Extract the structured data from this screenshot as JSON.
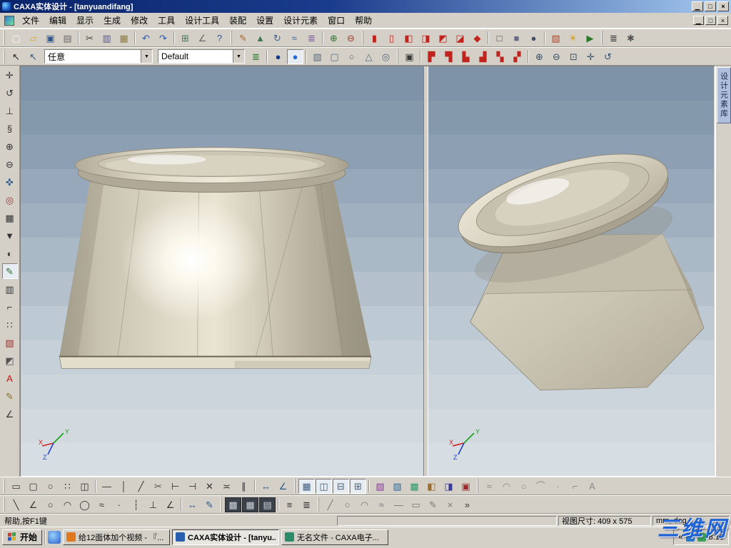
{
  "window": {
    "title": "CAXA实体设计 - [tanyuandifang]"
  },
  "icons": {
    "minimize": "▁",
    "maximize": "□",
    "close": "×",
    "combo_arrow": "▼",
    "tray_collapse": "«"
  },
  "menubar": {
    "items": [
      "文件",
      "编辑",
      "显示",
      "生成",
      "修改",
      "工具",
      "设计工具",
      "装配",
      "设置",
      "设计元素",
      "窗口",
      "帮助"
    ]
  },
  "toolbar_top": {
    "icons": [
      {
        "n": "toolbar-grip",
        "cls": "grip"
      },
      {
        "n": "new-file-icon",
        "g": "▢",
        "c": "#f8f8f4"
      },
      {
        "n": "open-file-icon",
        "g": "▱",
        "c": "#d8a83c"
      },
      {
        "n": "save-icon",
        "g": "▣",
        "c": "#31568c"
      },
      {
        "n": "print-icon",
        "g": "▤",
        "c": "#6a6a6a"
      },
      {
        "n": "separator",
        "cls": "sep",
        "iv": "false"
      },
      {
        "n": "cut-icon",
        "g": "✂",
        "c": "#444444"
      },
      {
        "n": "copy-icon",
        "g": "▥",
        "c": "#5a5a78"
      },
      {
        "n": "paste-icon",
        "g": "▦",
        "c": "#8a7a4a"
      },
      {
        "n": "separator",
        "cls": "sep",
        "iv": "false"
      },
      {
        "n": "undo-icon",
        "g": "↶",
        "c": "#2d56a8"
      },
      {
        "n": "redo-icon",
        "g": "↷",
        "c": "#2d56a8"
      },
      {
        "n": "separator",
        "cls": "sep",
        "iv": "false"
      },
      {
        "n": "grid-icon",
        "g": "⊞",
        "c": "#3a7a5a"
      },
      {
        "n": "measure-icon",
        "g": "∠",
        "c": "#666666"
      },
      {
        "n": "context-help-icon",
        "g": "?",
        "c": "#2d56a8"
      },
      {
        "n": "toolbar-grip",
        "cls": "grip"
      },
      {
        "n": "sketch-2d-icon",
        "g": "✎",
        "c": "#a8662a"
      },
      {
        "n": "extrude-feature-icon",
        "g": "▲",
        "c": "#3d7a52"
      },
      {
        "n": "revolve-feature-icon",
        "g": "↻",
        "c": "#35679e"
      },
      {
        "n": "sweep-feature-icon",
        "g": "≈",
        "c": "#35679e"
      },
      {
        "n": "loft-feature-icon",
        "g": "≣",
        "c": "#7a5aa0"
      },
      {
        "n": "separator",
        "cls": "sep",
        "iv": "false"
      },
      {
        "n": "boolean-add-icon",
        "g": "⊕",
        "c": "#2a7a2a"
      },
      {
        "n": "boolean-subtract-icon",
        "g": "⊖",
        "c": "#a03a2a"
      },
      {
        "n": "toolbar-grip",
        "cls": "grip"
      },
      {
        "n": "view-front-icon",
        "g": "▮",
        "c": "#c0241c"
      },
      {
        "n": "view-back-icon",
        "g": "▯",
        "c": "#c0241c"
      },
      {
        "n": "view-left-icon",
        "g": "◧",
        "c": "#c0241c"
      },
      {
        "n": "view-right-icon",
        "g": "◨",
        "c": "#c0241c"
      },
      {
        "n": "view-top-icon",
        "g": "◩",
        "c": "#c0241c"
      },
      {
        "n": "view-bottom-icon",
        "g": "◪",
        "c": "#c0241c"
      },
      {
        "n": "view-iso-icon",
        "g": "◆",
        "c": "#c0241c"
      },
      {
        "n": "separator",
        "cls": "sep",
        "iv": "false"
      },
      {
        "n": "display-wireframe-icon",
        "g": "□",
        "c": "#4a4a4a"
      },
      {
        "n": "display-shaded-icon",
        "g": "■",
        "c": "#6a6a8a"
      },
      {
        "n": "display-render-icon",
        "g": "●",
        "c": "#44506a"
      },
      {
        "n": "separator",
        "cls": "sep",
        "iv": "false"
      },
      {
        "n": "material-icon",
        "g": "▧",
        "c": "#b0452a"
      },
      {
        "n": "light-icon",
        "g": "☀",
        "c": "#d8a020"
      },
      {
        "n": "animation-icon",
        "g": "▶",
        "c": "#2a7a2a"
      },
      {
        "n": "toolbar-grip",
        "cls": "grip"
      },
      {
        "n": "design-tree-icon",
        "g": "≣",
        "c": "#333333"
      },
      {
        "n": "settings-icon",
        "g": "✱",
        "c": "#555555"
      }
    ]
  },
  "toolbar_second": {
    "filter_value": "任意",
    "style_value": "Default",
    "icons_left": [
      {
        "n": "toolbar-grip",
        "cls": "grip"
      },
      {
        "n": "select-tool-icon",
        "g": "↖",
        "c": "#222222"
      },
      {
        "n": "select-element-icon",
        "g": "↖",
        "c": "#2a5a8a"
      }
    ],
    "icons_mid": [
      {
        "n": "design-element-tree-icon",
        "g": "≣",
        "c": "#2a7a2a"
      },
      {
        "n": "separator",
        "cls": "sep",
        "iv": "false"
      },
      {
        "n": "material-dark-blue-icon",
        "g": "●",
        "c": "#123a8f"
      },
      {
        "n": "material-blue-icon",
        "g": "●",
        "c": "#1f6fe0",
        "a": 1
      },
      {
        "n": "separator",
        "cls": "sep",
        "iv": "false"
      },
      {
        "n": "box-primitive-icon",
        "g": "▧",
        "c": "#5a6a7a"
      },
      {
        "n": "cylinder-primitive-icon",
        "g": "▢",
        "c": "#5a6a7a"
      },
      {
        "n": "sphere-primitive-icon",
        "g": "○",
        "c": "#5a6a7a"
      },
      {
        "n": "cone-primitive-icon",
        "g": "△",
        "c": "#5a6a7a"
      },
      {
        "n": "torus-primitive-icon",
        "g": "◎",
        "c": "#5a6a7a"
      },
      {
        "n": "toolbar-grip",
        "cls": "grip"
      }
    ],
    "icons_right": [
      {
        "n": "render-scene-icon",
        "g": "▣",
        "c": "#3a3a3a"
      },
      {
        "n": "separator",
        "cls": "sep",
        "iv": "false"
      },
      {
        "n": "view-corner-nw-icon",
        "g": "▛",
        "c": "#c0241c"
      },
      {
        "n": "view-corner-ne-icon",
        "g": "▜",
        "c": "#c0241c"
      },
      {
        "n": "view-corner-sw-icon",
        "g": "▙",
        "c": "#c0241c"
      },
      {
        "n": "view-corner-se-icon",
        "g": "▟",
        "c": "#c0241c"
      },
      {
        "n": "view-diag-1-icon",
        "g": "▚",
        "c": "#c0241c"
      },
      {
        "n": "view-diag-2-icon",
        "g": "▞",
        "c": "#c0241c"
      },
      {
        "n": "separator",
        "cls": "sep",
        "iv": "false"
      },
      {
        "n": "zoom-in-icon",
        "g": "⊕",
        "c": "#35506a"
      },
      {
        "n": "zoom-out-icon",
        "g": "⊖",
        "c": "#35506a"
      },
      {
        "n": "zoom-extent-icon",
        "g": "⊡",
        "c": "#35506a"
      },
      {
        "n": "pan-view-icon",
        "g": "✛",
        "c": "#35506a"
      },
      {
        "n": "orbit-view-icon",
        "g": "↺",
        "c": "#35506a"
      }
    ]
  },
  "left_toolbar": {
    "icons": [
      {
        "n": "move-tool-icon",
        "g": "✛",
        "c": "#333333"
      },
      {
        "n": "rotate-tool-icon",
        "g": "↺",
        "c": "#333333"
      },
      {
        "n": "anchor-tool-icon",
        "g": "⊥",
        "c": "#333333"
      },
      {
        "n": "spring-tool-icon",
        "g": "§",
        "c": "#333333"
      },
      {
        "n": "zoom-in-tool-icon",
        "g": "⊕",
        "c": "#333333"
      },
      {
        "n": "zoom-out-tool-icon",
        "g": "⊖",
        "c": "#333333"
      },
      {
        "n": "pan-tool-icon",
        "g": "✜",
        "c": "#2a5a8a"
      },
      {
        "n": "target-point-icon",
        "g": "◎",
        "c": "#a03030"
      },
      {
        "n": "camera-tool-icon",
        "g": "▦",
        "c": "#333333"
      },
      {
        "n": "projector-tool-icon",
        "g": "▼",
        "c": "#333333"
      },
      {
        "n": "render-mode-icon",
        "g": "◐",
        "c": "#333333"
      },
      {
        "n": "edit-surface-icon",
        "g": "✎",
        "c": "#2a6a2a",
        "a": 1
      },
      {
        "n": "clipboard-tool-icon",
        "g": "▥",
        "c": "#333333"
      },
      {
        "n": "corner-tool-icon",
        "g": "⌐",
        "c": "#333333"
      },
      {
        "n": "array-tool-icon",
        "g": "∷",
        "c": "#333333"
      },
      {
        "n": "delete-red-icon",
        "g": "▨",
        "c": "#a03030"
      },
      {
        "n": "palette-tool-icon",
        "g": "◩",
        "c": "#555555"
      },
      {
        "n": "text-tool-icon",
        "g": "A",
        "c": "#c01818"
      },
      {
        "n": "pencil-tool-icon",
        "g": "✎",
        "c": "#8a6a2a"
      },
      {
        "n": "angle-tool-icon",
        "g": "∠",
        "c": "#333333"
      }
    ]
  },
  "viewport": {
    "axes": {
      "x": "X",
      "y": "Y",
      "z": "Z"
    }
  },
  "right_panel": {
    "tab": "设计元素库"
  },
  "bottom_toolbar_a": {
    "icons": [
      {
        "n": "toolbar-grip",
        "cls": "grip"
      },
      {
        "n": "rect-sketch-icon",
        "g": "▭",
        "c": "#333333"
      },
      {
        "n": "rounded-rect-icon",
        "g": "▢",
        "c": "#333333"
      },
      {
        "n": "circle-sketch-icon",
        "g": "○",
        "c": "#333333"
      },
      {
        "n": "grid-array-icon",
        "g": "∷",
        "c": "#333333"
      },
      {
        "n": "mirror-2d-icon",
        "g": "◫",
        "c": "#333333"
      },
      {
        "n": "separator",
        "cls": "sep",
        "iv": "false"
      },
      {
        "n": "line-h-icon",
        "g": "—",
        "c": "#333333"
      },
      {
        "n": "line-v-icon",
        "g": "│",
        "c": "#333333"
      },
      {
        "n": "line-angle-icon",
        "g": "╱",
        "c": "#333333"
      },
      {
        "n": "trim-icon",
        "g": "✂",
        "c": "#555555"
      },
      {
        "n": "extend-icon",
        "g": "⊢",
        "c": "#333333"
      },
      {
        "n": "break-icon",
        "g": "⊣",
        "c": "#333333"
      },
      {
        "n": "intersect-icon",
        "g": "✕",
        "c": "#333333"
      },
      {
        "n": "offset-icon",
        "g": "≍",
        "c": "#333333"
      },
      {
        "n": "parallel-icon",
        "g": "∥",
        "c": "#333333"
      },
      {
        "n": "separator",
        "cls": "sep",
        "iv": "false"
      },
      {
        "n": "dim-linear-icon",
        "g": "↔",
        "c": "#2a5a8a"
      },
      {
        "n": "dim-angular-icon",
        "g": "∠",
        "c": "#2a5a8a"
      },
      {
        "n": "toolbar-grip",
        "cls": "grip"
      },
      {
        "n": "view-layout-one-icon",
        "g": "▦",
        "c": "#44607c",
        "a": 1
      },
      {
        "n": "view-layout-two-v-icon",
        "g": "◫",
        "c": "#44607c",
        "a": 1
      },
      {
        "n": "view-layout-two-h-icon",
        "g": "⊟",
        "c": "#44607c",
        "a": 1
      },
      {
        "n": "view-layout-quad-icon",
        "g": "⊞",
        "c": "#44607c",
        "a": 1
      },
      {
        "n": "separator",
        "cls": "sep",
        "iv": "false"
      },
      {
        "n": "viewport-new-icon",
        "g": "▧",
        "c": "#8a3a9a"
      },
      {
        "n": "viewport-sync-icon",
        "g": "▨",
        "c": "#2a6a9a"
      },
      {
        "n": "viewport-lock-icon",
        "g": "▩",
        "c": "#2a9a6a"
      },
      {
        "n": "viewport-cfg-icon",
        "g": "◧",
        "c": "#9a6a2a"
      },
      {
        "n": "viewport-split-icon",
        "g": "◨",
        "c": "#3a3a9a"
      },
      {
        "n": "viewport-close-icon",
        "g": "▣",
        "c": "#9a2a2a"
      },
      {
        "n": "toolbar-grip",
        "cls": "grip"
      },
      {
        "n": "spline-tool-icon",
        "g": "≈",
        "c": "#8a8a8a"
      },
      {
        "n": "arc-tool-icon",
        "g": "◠",
        "c": "#8a8a8a"
      },
      {
        "n": "circle-tool-icon",
        "g": "○",
        "c": "#8a8a8a"
      },
      {
        "n": "tangent-tool-icon",
        "g": "⌒",
        "c": "#8a8a8a"
      },
      {
        "n": "point-tool-icon",
        "g": "·",
        "c": "#8a8a8a"
      },
      {
        "n": "corner2-tool-icon",
        "g": "⌐",
        "c": "#8a8a8a"
      },
      {
        "n": "letter-tool-icon",
        "g": "A",
        "c": "#8a8a8a"
      }
    ]
  },
  "bottom_toolbar_b": {
    "icons": [
      {
        "n": "toolbar-grip",
        "cls": "grip"
      },
      {
        "n": "line-2d-icon",
        "g": "╲",
        "c": "#333333"
      },
      {
        "n": "polyline-2d-icon",
        "g": "∠",
        "c": "#333333"
      },
      {
        "n": "circle-2d-icon",
        "g": "○",
        "c": "#333333"
      },
      {
        "n": "arc-2d-icon",
        "g": "◠",
        "c": "#333333"
      },
      {
        "n": "ellipse-2d-icon",
        "g": "◯",
        "c": "#333333"
      },
      {
        "n": "spline-2d-icon",
        "g": "≈",
        "c": "#333333"
      },
      {
        "n": "point-2d-icon",
        "g": "·",
        "c": "#333333"
      },
      {
        "n": "ref-line-icon",
        "g": "┆",
        "c": "#333333"
      },
      {
        "n": "perp-constraint-icon",
        "g": "⊥",
        "c": "#333333"
      },
      {
        "n": "angle-constraint-icon",
        "g": "∠",
        "c": "#333333"
      },
      {
        "n": "separator",
        "cls": "sep",
        "iv": "false"
      },
      {
        "n": "dim-2d-icon",
        "g": "↔",
        "c": "#2a5a8a"
      },
      {
        "n": "annotate-icon",
        "g": "✎",
        "c": "#2a5a8a"
      },
      {
        "n": "toolbar-grip",
        "cls": "grip"
      },
      {
        "n": "render-bg-1-icon",
        "g": "▩",
        "c": "#cfd4da",
        "b": "#3a4148",
        "cls": "ti dark"
      },
      {
        "n": "render-bg-2-icon",
        "g": "▦",
        "c": "#cfd4da",
        "b": "#3a4148",
        "cls": "ti dark"
      },
      {
        "n": "render-bg-3-icon",
        "g": "▤",
        "c": "#cfd4da",
        "b": "#3a4148",
        "cls": "ti dark"
      },
      {
        "n": "separator",
        "cls": "sep",
        "iv": "false"
      },
      {
        "n": "layer-list-icon",
        "g": "≡",
        "c": "#333333"
      },
      {
        "n": "props-list-icon",
        "g": "≣",
        "c": "#333333"
      },
      {
        "n": "toolbar-grip",
        "cls": "grip"
      },
      {
        "n": "sketch-line-icon",
        "g": "╱",
        "c": "#777777"
      },
      {
        "n": "sketch-circle-icon",
        "g": "○",
        "c": "#777777"
      },
      {
        "n": "sketch-arc-icon",
        "g": "◠",
        "c": "#777777"
      },
      {
        "n": "sketch-spline-icon",
        "g": "≈",
        "c": "#777777"
      },
      {
        "n": "sketch-h-line-icon",
        "g": "—",
        "c": "#777777"
      },
      {
        "n": "sketch-rect-icon",
        "g": "▭",
        "c": "#777777"
      },
      {
        "n": "sketch-edit-icon",
        "g": "✎",
        "c": "#777777"
      },
      {
        "n": "sketch-erase-icon",
        "g": "×",
        "c": "#777777"
      },
      {
        "n": "toolbar-more-icon",
        "g": "»",
        "c": "#333333"
      }
    ]
  },
  "statusbar": {
    "help": "帮助,按F1键",
    "view_size": "视图尺寸: 409 x 575",
    "units": "mm, deg"
  },
  "taskbar": {
    "start": "开始",
    "tasks": [
      {
        "label": "给12面体加个视频 - 『...",
        "ic": "#e07820"
      },
      {
        "label": "CAXA实体设计 - [tanyu...",
        "ic": "#2a5fb0",
        "a": 1
      },
      {
        "label": "无名文件 - CAXA电子...",
        "ic": "#2a8a6a"
      }
    ],
    "time": "8:13"
  },
  "watermark": "三维网",
  "colors": {
    "titlebar_left": "#0a246a",
    "titlebar_right": "#a6caf0",
    "chrome": "#d4d0c8",
    "viewport_top_band": "#7e92a8",
    "viewport_bottom_band": "#d7dee3",
    "model_beige": "#d2ccba",
    "icon_red": "#c0241c",
    "watermark_blue": "#1f63d6"
  }
}
